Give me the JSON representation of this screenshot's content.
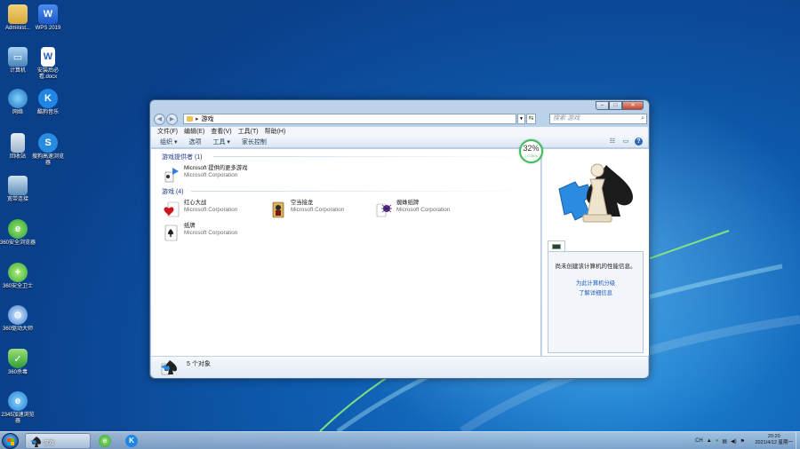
{
  "desktop_icons": [
    {
      "label": "Administ...",
      "icon": "user-folder-icon"
    },
    {
      "label": "WPS 2019",
      "icon": "wps-icon"
    },
    {
      "label": "计算机",
      "icon": "computer-icon"
    },
    {
      "label": "安装后必看.docx",
      "icon": "word-document-icon"
    },
    {
      "label": "网络",
      "icon": "network-icon"
    },
    {
      "label": "酷狗音乐",
      "icon": "kugou-icon"
    },
    {
      "label": "回收站",
      "icon": "recycle-bin-icon"
    },
    {
      "label": "搜狗高速浏览器",
      "icon": "sogou-browser-icon"
    },
    {
      "label": "宽带连接",
      "icon": "broadband-icon"
    },
    {
      "label": "360安全浏览器",
      "icon": "360-browser-icon"
    },
    {
      "label": "360安全卫士",
      "icon": "360-security-icon"
    },
    {
      "label": "360驱动大师",
      "icon": "360-driver-icon"
    },
    {
      "label": "360杀毒",
      "icon": "360-antivirus-icon"
    },
    {
      "label": "2345加速浏览器",
      "icon": "2345-browser-icon"
    }
  ],
  "window": {
    "address_path": "游戏",
    "search_placeholder": "搜索 游戏",
    "menu": [
      "文件(F)",
      "编辑(E)",
      "查看(V)",
      "工具(T)",
      "帮助(H)"
    ],
    "toolbar": [
      "组织 ▾",
      "选项",
      "工具 ▾",
      "家长控制"
    ],
    "groups": [
      {
        "header": "游戏提供者 (1)",
        "items": [
          {
            "name": "Microsoft 提供的更多游戏",
            "publisher": "Microsoft Corporation",
            "icon": "more-games-icon"
          }
        ]
      },
      {
        "header": "游戏 (4)",
        "items": [
          {
            "name": "红心大战",
            "publisher": "Microsoft Corporation",
            "icon": "hearts-icon"
          },
          {
            "name": "空当接龙",
            "publisher": "Microsoft Corporation",
            "icon": "freecell-icon"
          },
          {
            "name": "蜘蛛纸牌",
            "publisher": "Microsoft Corporation",
            "icon": "spider-solitaire-icon"
          },
          {
            "name": "纸牌",
            "publisher": "Microsoft Corporation",
            "icon": "solitaire-icon"
          }
        ]
      }
    ],
    "preview": {
      "image": "games-chess-puzzle-icon",
      "perf_message": "尚未创建该计算机的性能信息。",
      "link_rate": "为此计算机分级",
      "link_more": "了解详细信息"
    },
    "status": "5 个对象"
  },
  "net_meter": {
    "percent": "32%",
    "speed": "↓ 0.2K/s"
  },
  "taskbar": {
    "active_task": "游戏",
    "tray_text": "CH",
    "time": "20:20",
    "date": "2021/4/12 星期一"
  },
  "colors": {
    "accent": "#1e3a8a",
    "link": "#1f5fc4",
    "meter": "#3bbf5a"
  }
}
